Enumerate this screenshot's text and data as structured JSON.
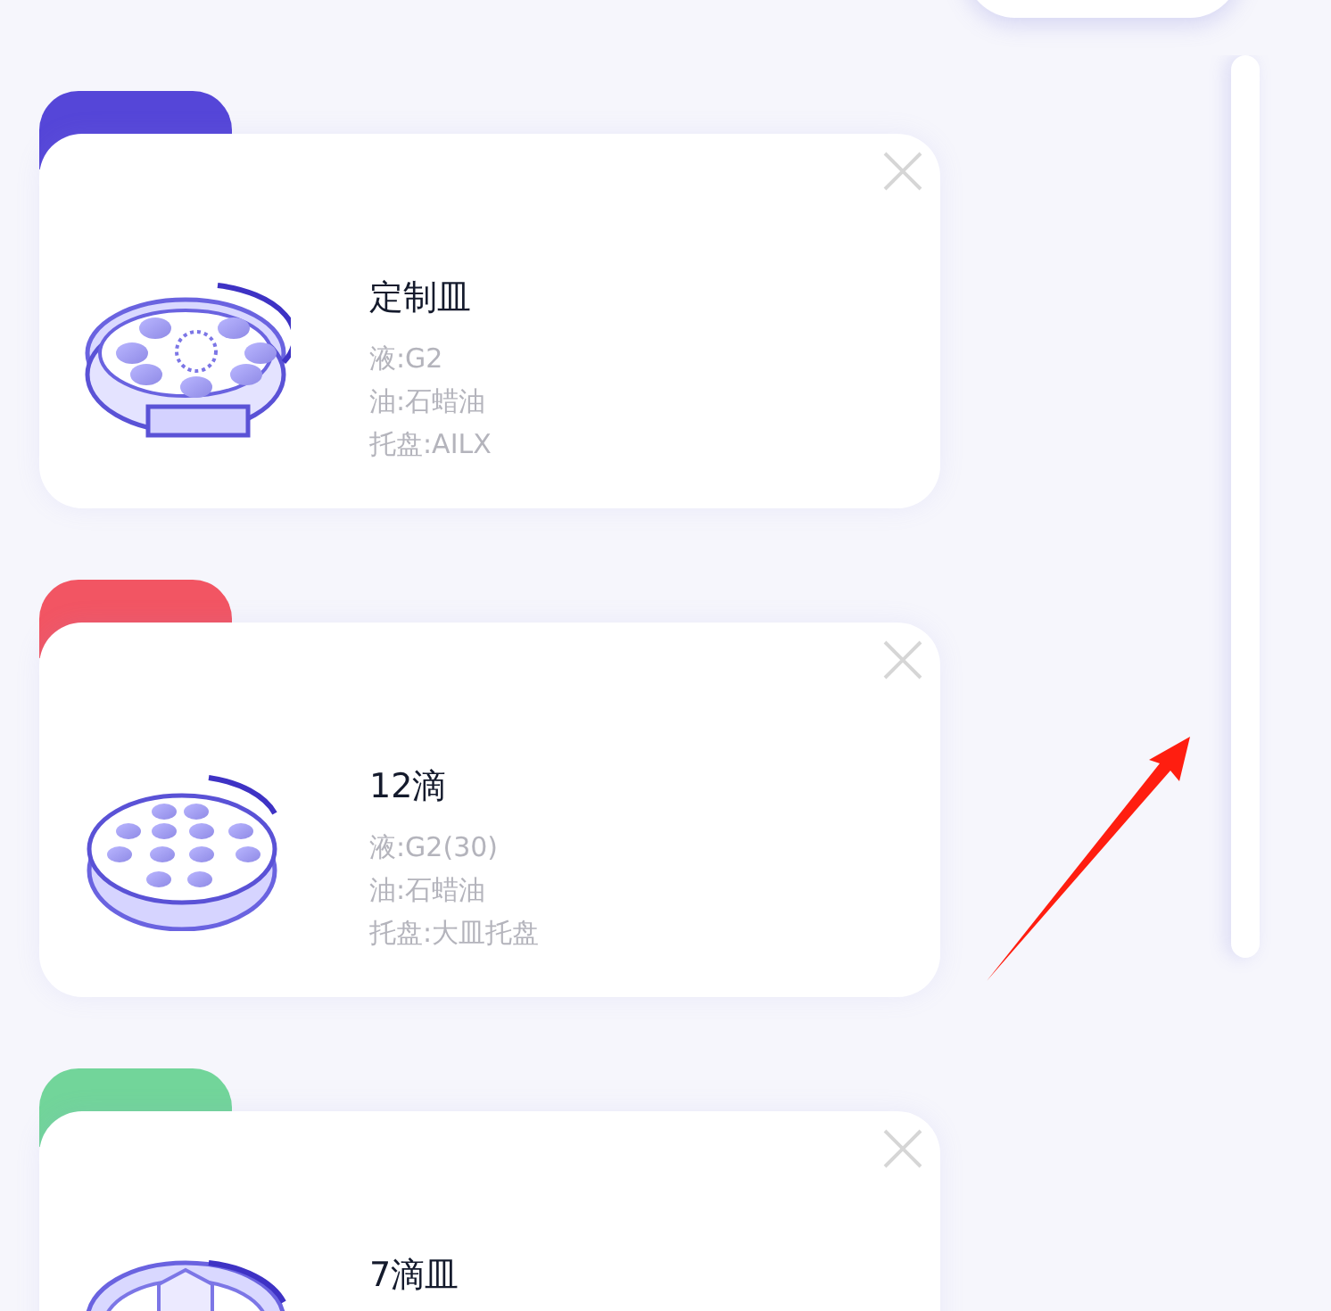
{
  "dishes": [
    {
      "kind": "custom",
      "color": "#5546d8",
      "name": "定制皿",
      "details": [
        "液:G2",
        "油:石蜡油",
        "托盘:AILX"
      ]
    },
    {
      "kind": "drops12",
      "color": "#f25563",
      "name": "12滴",
      "details": [
        "液:G2(30)",
        "油:石蜡油",
        "托盘:大皿托盘"
      ]
    },
    {
      "kind": "drops7",
      "color": "#72d59a",
      "name": "7滴皿"
    }
  ]
}
